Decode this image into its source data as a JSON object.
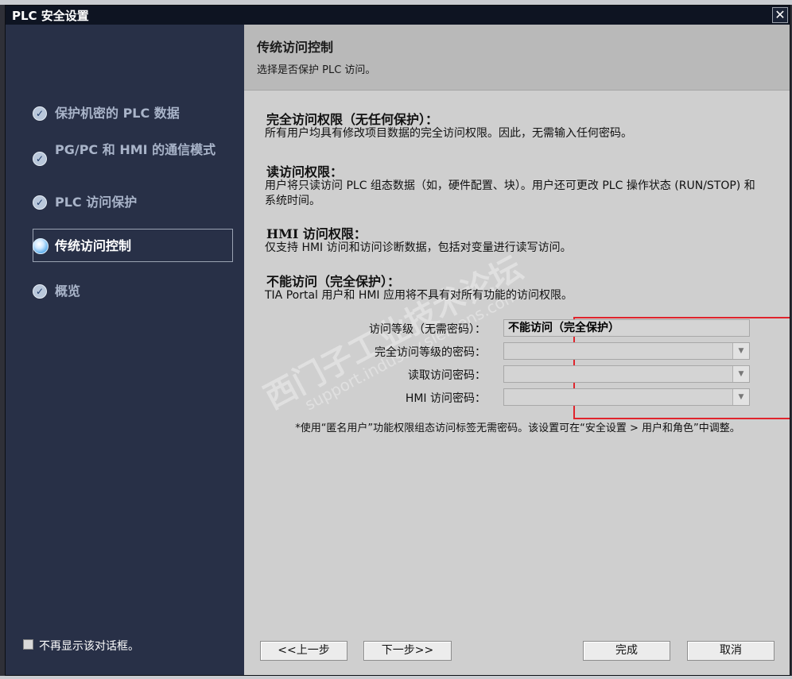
{
  "window": {
    "title": "PLC 安全设置",
    "close_glyph": "✕"
  },
  "sidebar": {
    "items": [
      {
        "label": "保护机密的 PLC 数据",
        "state": "done"
      },
      {
        "label": "PG/PC 和 HMI 的通信模式",
        "state": "done"
      },
      {
        "label": "PLC 访问保护",
        "state": "done"
      },
      {
        "label": "传统访问控制",
        "state": "active"
      },
      {
        "label": "概览",
        "state": "done"
      }
    ],
    "dont_show_label": "不再显示该对话框。"
  },
  "header": {
    "title": "传统访问控制",
    "subtitle": "选择是否保护 PLC 访问。"
  },
  "sections": [
    {
      "heading": "完全访问权限（无任何保护）：",
      "text": "所有用户均具有修改项目数据的完全访问权限。因此，无需输入任何密码。"
    },
    {
      "heading": "读访问权限：",
      "text": "用户将只读访问 PLC 组态数据（如，硬件配置、块）。用户还可更改 PLC 操作状态 (RUN/STOP) 和系统时间。"
    },
    {
      "heading": "HMI 访问权限：",
      "text": "仅支持 HMI 访问和访问诊断数据，包括对变量进行读写访问。"
    },
    {
      "heading": "不能访问（完全保护）：",
      "text": "TIA Portal 用户和 HMI 应用将不具有对所有功能的访问权限。"
    }
  ],
  "form": {
    "fields": [
      {
        "label": "访问等级（无需密码）：",
        "value": "不能访问（完全保护）"
      },
      {
        "label": "完全访问等级的密码：",
        "value": ""
      },
      {
        "label": "读取访问密码：",
        "value": ""
      },
      {
        "label": "HMI 访问密码：",
        "value": ""
      }
    ],
    "accent_color": "#e0242c"
  },
  "note": "*使用“匿名用户”功能权限组态访问标签无需密码。该设置可在“安全设置 > 用户和角色”中调整。",
  "watermark": {
    "line1": "西门子工业技术论坛",
    "line2": "support.industry.siemens.com"
  },
  "buttons": {
    "back": "<<上一步",
    "next": "下一步>>",
    "finish": "完成",
    "cancel": "取消"
  },
  "colors": {
    "sidebar_bg": "#283047",
    "content_bg": "#cfcfcf",
    "header_bg": "#b9b9b9",
    "title_bar": "#0e1422"
  }
}
